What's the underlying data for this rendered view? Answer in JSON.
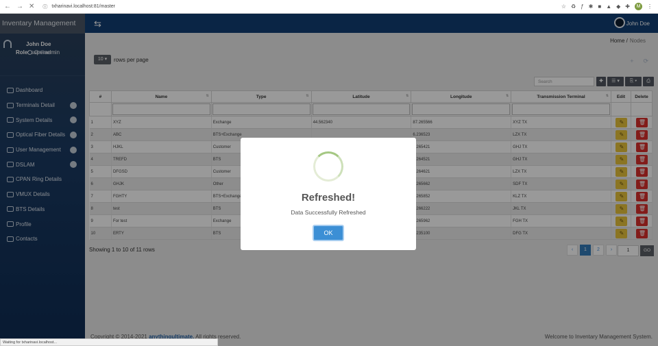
{
  "browser": {
    "url": "txharinavi.localhost:81/master",
    "status_text": "Waiting for txharinavi.localhost..."
  },
  "sidebar": {
    "brand": "Inventary Management",
    "user_name": "John Doe",
    "role_label": "Role:",
    "role_value": "superadmin",
    "status": "Online",
    "items": [
      {
        "label": "Dashboard",
        "badge": false
      },
      {
        "label": "Terminals Detail",
        "badge": true
      },
      {
        "label": "System Details",
        "badge": true
      },
      {
        "label": "Optical Fiber Details",
        "badge": true
      },
      {
        "label": "User Management",
        "badge": true
      },
      {
        "label": "DSLAM",
        "badge": true
      },
      {
        "label": "CPAN Ring Details",
        "badge": false
      },
      {
        "label": "VMUX Details",
        "badge": false
      },
      {
        "label": "BTS Details",
        "badge": false
      },
      {
        "label": "Profile",
        "badge": false
      },
      {
        "label": "Contacts",
        "badge": false
      }
    ]
  },
  "topbar": {
    "user_name": "John Doe"
  },
  "breadcrumb": {
    "home": "Home /",
    "current": "Nodes"
  },
  "table_controls": {
    "rows_per_page_value": "10",
    "rows_per_page_label": "rows per page",
    "search_placeholder": "Search"
  },
  "table": {
    "columns": [
      "#",
      "Name",
      "Type",
      "Latitude",
      "Longitude",
      "Transmission Terminal",
      "Edit",
      "Delete"
    ],
    "rows": [
      {
        "num": "1",
        "name": "XYZ",
        "type": "Exchange",
        "latitude": "44.562340",
        "longitude": "87.265566",
        "terminal": "XYZ TX"
      },
      {
        "num": "2",
        "name": "ABC",
        "type": "BTS+Exchange",
        "latitude": "",
        "longitude": "6.236523",
        "terminal": "LZX TX"
      },
      {
        "num": "3",
        "name": "HJKL",
        "type": "Customer",
        "latitude": "",
        "longitude": "6.265421",
        "terminal": "GHJ TX"
      },
      {
        "num": "4",
        "name": "TREFD",
        "type": "BTS",
        "latitude": "",
        "longitude": "6.264521",
        "terminal": "GHJ TX"
      },
      {
        "num": "5",
        "name": "DFGSD",
        "type": "Customer",
        "latitude": "",
        "longitude": "6.264621",
        "terminal": "LZX TX"
      },
      {
        "num": "6",
        "name": "GHJK",
        "type": "Other",
        "latitude": "",
        "longitude": "6.265662",
        "terminal": "SDF TX"
      },
      {
        "num": "7",
        "name": "FGHTY",
        "type": "BTS+Exchange",
        "latitude": "",
        "longitude": "6.265852",
        "terminal": "KLZ TX"
      },
      {
        "num": "8",
        "name": "test",
        "type": "BTS",
        "latitude": "",
        "longitude": "6.266222",
        "terminal": "JKL TX"
      },
      {
        "num": "9",
        "name": "For test",
        "type": "Exchange",
        "latitude": "",
        "longitude": "6.265962",
        "terminal": "FGH TX"
      },
      {
        "num": "10",
        "name": "ERTY",
        "type": "BTS",
        "latitude": "",
        "longitude": "6.235100",
        "terminal": "DFG TX"
      }
    ]
  },
  "pagination": {
    "showing": "Showing 1 to 10 of 11 rows",
    "prev": "‹",
    "page1": "1",
    "page2": "2",
    "next": "›",
    "goto_value": "1",
    "go_label": "GO"
  },
  "footer": {
    "copyright_prefix": "Copyright © 2014-2021",
    "company": "anythingultimate.",
    "rights": "All rights reserved.",
    "welcome": "Welcome to Inventary Management System."
  },
  "dialog": {
    "title": "Refreshed!",
    "message": "Data Successfully Refreshed",
    "ok_label": "OK"
  },
  "colors": {
    "topbar": "#123e73",
    "sidebar": "#0e2c54",
    "ok_button": "#3c8fd5",
    "edit_button": "#e8c33b",
    "delete_button": "#d9302c",
    "page_active": "#337ab7"
  }
}
